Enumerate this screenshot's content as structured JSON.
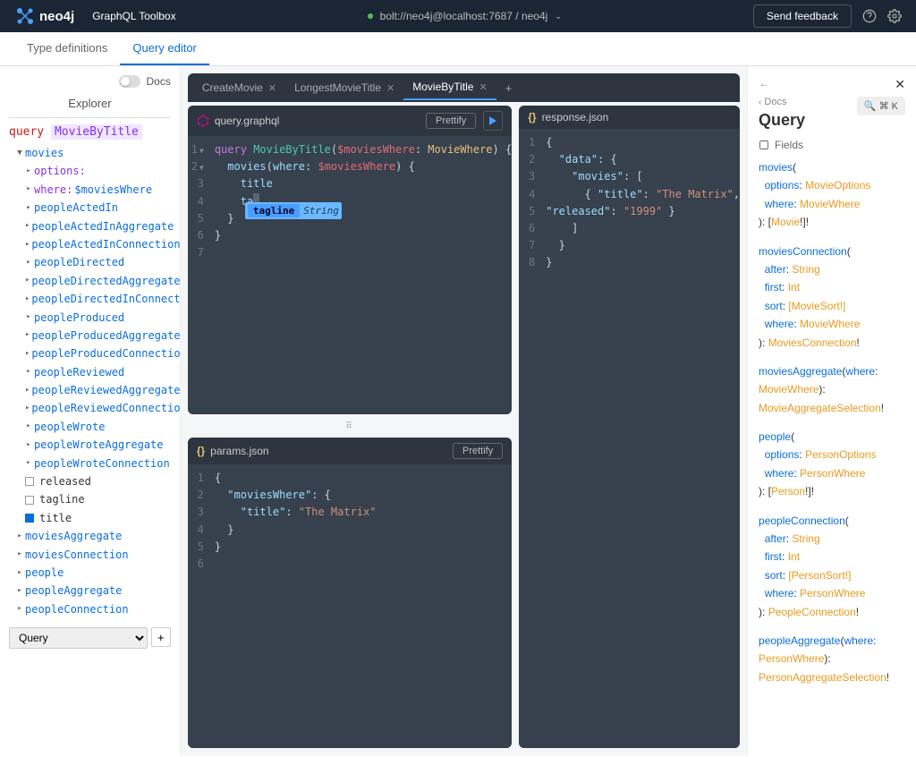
{
  "header": {
    "appName": "GraphQL Toolbox",
    "connection": "bolt://neo4j@localhost:7687 / neo4j",
    "feedback": "Send feedback"
  },
  "nav": {
    "typeDefs": "Type definitions",
    "queryEditor": "Query editor"
  },
  "explorer": {
    "docsLabel": "Docs",
    "title": "Explorer",
    "queryKw": "query",
    "queryName": "MovieByTitle",
    "root": "movies",
    "optionsLabel": "options:",
    "whereLabel": "where:",
    "whereVar": "$moviesWhere",
    "children": [
      "peopleActedIn",
      "peopleActedInAggregate",
      "peopleActedInConnection",
      "peopleDirected",
      "peopleDirectedAggregate",
      "peopleDirectedInConnection",
      "peopleProduced",
      "peopleProducedAggregate",
      "peopleProducedConnection",
      "peopleReviewed",
      "peopleReviewedAggregate",
      "peopleReviewedConnection",
      "peopleWrote",
      "peopleWroteAggregate",
      "peopleWroteConnection"
    ],
    "releasedField": "released",
    "taglineField": "tagline",
    "titleField": "title",
    "siblings": [
      "moviesAggregate",
      "moviesConnection",
      "people",
      "peopleAggregate",
      "peopleConnection"
    ],
    "selectValue": "Query"
  },
  "tabs": {
    "items": [
      "CreateMovie",
      "LongestMovieTitle",
      "MovieByTitle"
    ],
    "activeIndex": 2
  },
  "queryEditor": {
    "filename": "query.graphql",
    "prettify": "Prettify",
    "lines": {
      "kw": "query",
      "name": "MovieByTitle",
      "var": "$moviesWhere",
      "type": "MovieWhere",
      "moviesCall": "movies",
      "whereArg": "where",
      "titleField": "title",
      "partial": "ta"
    },
    "suggest": {
      "name": "tagline",
      "type": "String"
    }
  },
  "params": {
    "filename": "params.json",
    "prettify": "Prettify",
    "key1": "moviesWhere",
    "key2": "title",
    "val2": "The Matrix"
  },
  "response": {
    "filename": "response.json",
    "data": "data",
    "movies": "movies",
    "titleKey": "title",
    "titleVal": "The Matrix",
    "releasedKey": "released",
    "releasedVal": "1999"
  },
  "docs": {
    "back": "Docs",
    "title": "Query",
    "shortcut": "⌘ K",
    "fieldsLabel": "Fields",
    "entries": [
      {
        "name": "movies",
        "args": [
          [
            "options",
            "MovieOptions"
          ],
          [
            "where",
            "MovieWhere"
          ]
        ],
        "ret": "Movie",
        "retSuffix": "!]!",
        "retPrefix": ": ["
      },
      {
        "name": "moviesConnection",
        "args": [
          [
            "after",
            "String"
          ],
          [
            "first",
            "Int"
          ],
          [
            "sort",
            "[MovieSort!]"
          ],
          [
            "where",
            "MovieWhere"
          ]
        ],
        "ret": "MoviesConnection",
        "retSuffix": "!",
        "retPrefix": ": "
      },
      {
        "name": "moviesAggregate",
        "args": [
          [
            "where",
            "MovieWhere"
          ]
        ],
        "ret": "MovieAggregateSelection",
        "retSuffix": "!",
        "retPrefix": ": ",
        "inline": true
      },
      {
        "name": "people",
        "args": [
          [
            "options",
            "PersonOptions"
          ],
          [
            "where",
            "PersonWhere"
          ]
        ],
        "ret": "Person",
        "retSuffix": "!]!",
        "retPrefix": ": ["
      },
      {
        "name": "peopleConnection",
        "args": [
          [
            "after",
            "String"
          ],
          [
            "first",
            "Int"
          ],
          [
            "sort",
            "[PersonSort!]"
          ],
          [
            "where",
            "PersonWhere"
          ]
        ],
        "ret": "PeopleConnection",
        "retSuffix": "!",
        "retPrefix": ": "
      },
      {
        "name": "peopleAggregate",
        "args": [
          [
            "where",
            "PersonWhere"
          ]
        ],
        "ret": "PersonAggregateSelection",
        "retSuffix": "!",
        "retPrefix": ": ",
        "inline": true
      }
    ]
  }
}
